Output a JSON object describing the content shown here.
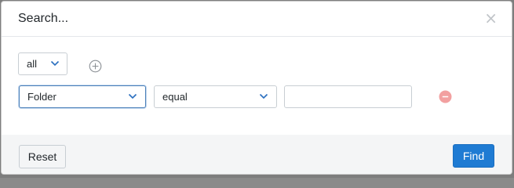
{
  "dialog": {
    "title": "Search...",
    "close_glyph": "×"
  },
  "query": {
    "match_mode": "all",
    "add_condition_icon": "plus-circle-icon",
    "conditions": [
      {
        "field": "Folder",
        "operator": "equal",
        "value": "",
        "remove_icon": "minus-circle-icon"
      }
    ]
  },
  "footer": {
    "reset_label": "Reset",
    "find_label": "Find"
  },
  "colors": {
    "primary": "#1f7bd3",
    "remove": "#f2a0a0",
    "focus_border": "#4a7fb8"
  }
}
